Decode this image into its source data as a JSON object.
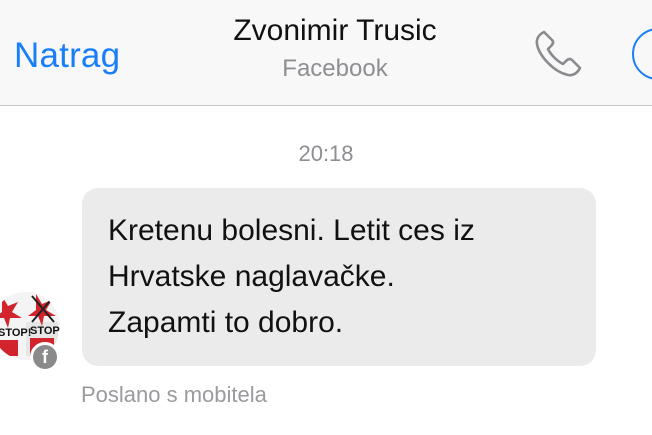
{
  "header": {
    "back_label": "Natrag",
    "contact_name": "Zvonimir Trusic",
    "contact_source": "Facebook",
    "phone_icon": "phone-icon",
    "info_icon": "info-icon"
  },
  "conversation": {
    "timestamp": "20:18",
    "message_lines": [
      "Kretenu bolesni. Letit ces iz",
      "Hrvatske naglavačke.",
      "Zapamti to dobro."
    ],
    "sent_from": "Poslano s mobitela",
    "avatar_text": "STOP!",
    "badge_glyph": "f"
  },
  "colors": {
    "accent": "#1a7ef7",
    "bubble": "#ebebeb",
    "secondary_text": "#8e8e93"
  }
}
